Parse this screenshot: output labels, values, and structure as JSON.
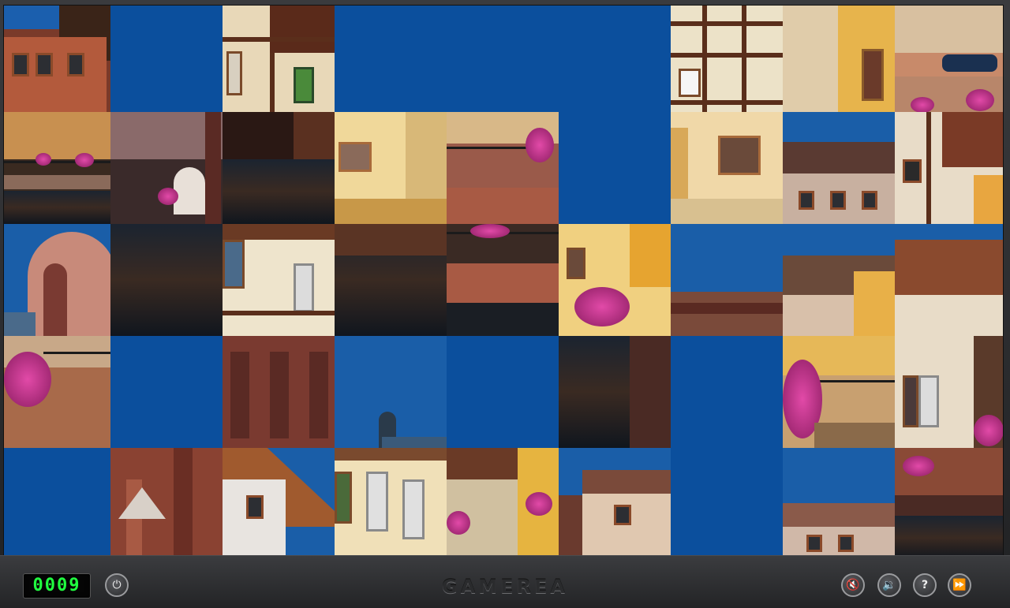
{
  "game": {
    "timer": "0009",
    "logo": "GAMEREA"
  },
  "controls": {
    "power": "power-icon",
    "mute": "speaker-mute-icon",
    "sound": "speaker-icon",
    "help": "?",
    "skip": "fast-forward-icon"
  },
  "palette": {
    "empty_tile": "#0b4f9d",
    "sky": "#1660ad",
    "timer_digits": "#20ff40"
  },
  "board": {
    "columns": 9,
    "rows": 5,
    "empty_tiles": [
      [
        0,
        1
      ],
      [
        0,
        3
      ],
      [
        0,
        4
      ],
      [
        0,
        5
      ],
      [
        1,
        5
      ],
      [
        2,
        6
      ],
      [
        3,
        1
      ],
      [
        3,
        3
      ],
      [
        3,
        4
      ],
      [
        3,
        6
      ],
      [
        4,
        0
      ],
      [
        4,
        6
      ]
    ]
  }
}
